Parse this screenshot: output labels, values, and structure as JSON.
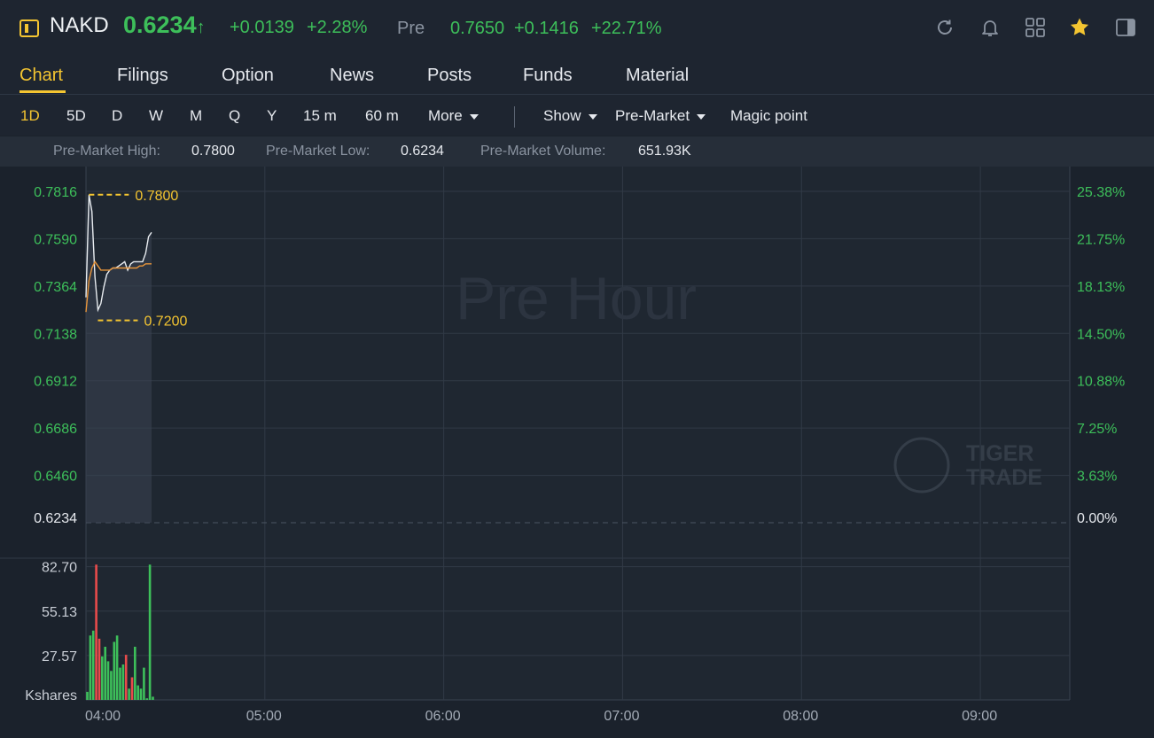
{
  "header": {
    "ticker": "NAKD",
    "price": "0.6234",
    "price_arrow": "↑",
    "change": "+0.0139",
    "change_pct": "+2.28%",
    "session_label": "Pre",
    "pre_price": "0.7650",
    "pre_change": "+0.1416",
    "pre_change_pct": "+22.71%",
    "icons": [
      "refresh-icon",
      "bell-icon",
      "grid-icon",
      "star-icon",
      "panel-icon"
    ]
  },
  "tabs": [
    {
      "label": "Chart",
      "active": true
    },
    {
      "label": "Filings"
    },
    {
      "label": "Option"
    },
    {
      "label": "News"
    },
    {
      "label": "Posts"
    },
    {
      "label": "Funds"
    },
    {
      "label": "Material"
    }
  ],
  "toolbar": {
    "periods": [
      "1D",
      "5D",
      "D",
      "W",
      "M",
      "Q",
      "Y",
      "15 m",
      "60 m"
    ],
    "active_period": "1D",
    "more_label": "More",
    "show_label": "Show",
    "session_select": "Pre-Market",
    "magic_label": "Magic point"
  },
  "stats": {
    "high_label": "Pre-Market High:",
    "high_value": "0.7800",
    "low_label": "Pre-Market Low:",
    "low_value": "0.6234",
    "volume_label": "Pre-Market Volume:",
    "volume_value": "651.93K"
  },
  "colors": {
    "accent": "#f4c531",
    "up": "#3dbf5a",
    "down": "#e84b4b",
    "price_line": "#e8ecf0",
    "avg_line": "#e8953a"
  },
  "chart_data": {
    "type": "line",
    "watermark": "Pre Hour",
    "brand_watermark": [
      "TIGER",
      "TRADE"
    ],
    "x_ticks": [
      "04:00",
      "05:00",
      "06:00",
      "07:00",
      "08:00",
      "09:00"
    ],
    "x_range_minutes": [
      0,
      330
    ],
    "y_ticks_price": [
      "0.7816",
      "0.7590",
      "0.7364",
      "0.7138",
      "0.6912",
      "0.6686",
      "0.6460",
      "0.6234"
    ],
    "y_ticks_pct": [
      "25.38%",
      "21.75%",
      "18.13%",
      "14.50%",
      "10.88%",
      "7.25%",
      "3.63%",
      "0.00%"
    ],
    "ylim": [
      0.6234,
      0.7816
    ],
    "prev_close": 0.6234,
    "high_marker": {
      "value": 0.78,
      "label": "0.7800"
    },
    "low_marker": {
      "value": 0.72,
      "label": "0.7200"
    },
    "series": [
      {
        "x": [
          0,
          1,
          2,
          3,
          4,
          5,
          6,
          7,
          8,
          9,
          10,
          11,
          12,
          13,
          14,
          15,
          16,
          17,
          18,
          19,
          20,
          21,
          22
        ],
        "values": [
          0.731,
          0.78,
          0.772,
          0.741,
          0.725,
          0.728,
          0.736,
          0.742,
          0.744,
          0.745,
          0.745,
          0.746,
          0.747,
          0.748,
          0.744,
          0.747,
          0.748,
          0.748,
          0.748,
          0.748,
          0.752,
          0.76,
          0.762
        ]
      },
      {
        "x": [
          0,
          1,
          2,
          3,
          4,
          5,
          6,
          7,
          8,
          9,
          10,
          11,
          12,
          13,
          14,
          15,
          16,
          17,
          18,
          19,
          20,
          21,
          22
        ],
        "values": [
          0.724,
          0.739,
          0.745,
          0.748,
          0.746,
          0.744,
          0.744,
          0.744,
          0.744,
          0.745,
          0.745,
          0.745,
          0.745,
          0.745,
          0.745,
          0.745,
          0.745,
          0.745,
          0.746,
          0.746,
          0.747,
          0.747,
          0.747
        ]
      }
    ],
    "volume": {
      "unit_label": "Kshares",
      "y_ticks": [
        "82.70",
        "55.13",
        "27.57"
      ],
      "ylim": [
        0,
        88
      ],
      "x": [
        0,
        1,
        2,
        3,
        4,
        5,
        6,
        7,
        8,
        9,
        10,
        11,
        12,
        13,
        14,
        15,
        16,
        17,
        18,
        19,
        20,
        21,
        22
      ],
      "values": [
        5,
        40,
        43,
        84,
        38,
        27,
        33,
        24,
        18,
        36,
        40,
        20,
        22,
        28,
        7,
        14,
        33,
        9,
        7,
        20,
        1,
        84,
        2
      ],
      "directions": [
        "up",
        "up",
        "up",
        "down",
        "down",
        "up",
        "up",
        "up",
        "up",
        "up",
        "up",
        "up",
        "up",
        "down",
        "up",
        "down",
        "up",
        "up",
        "up",
        "up",
        "up",
        "up",
        "up"
      ]
    }
  }
}
